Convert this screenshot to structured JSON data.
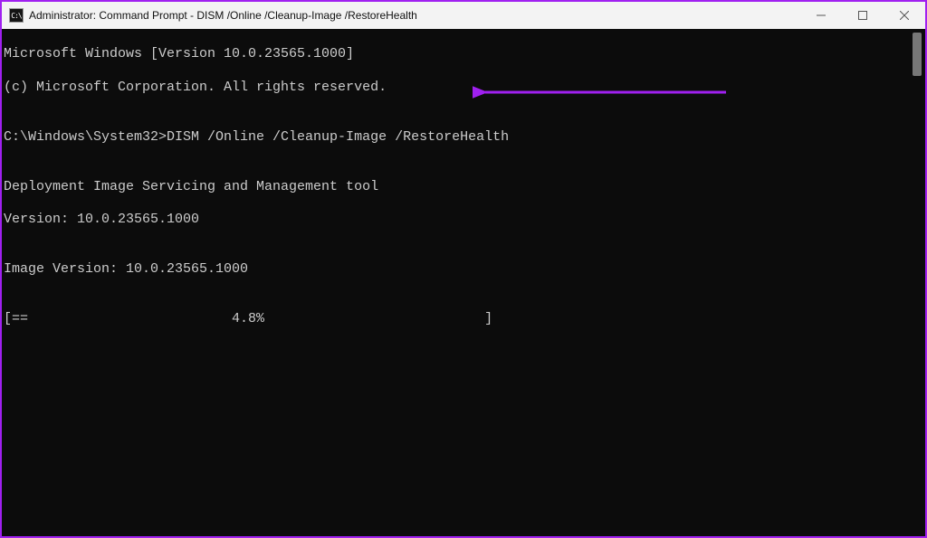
{
  "title": "Administrator: Command Prompt - DISM  /Online /Cleanup-Image /RestoreHealth",
  "app_icon_label": "C:\\",
  "console": {
    "line1": "Microsoft Windows [Version 10.0.23565.1000]",
    "line2": "(c) Microsoft Corporation. All rights reserved.",
    "blank1": "",
    "prompt_line": "C:\\Windows\\System32>DISM /Online /Cleanup-Image /RestoreHealth",
    "blank2": "",
    "tool_line1": "Deployment Image Servicing and Management tool",
    "tool_line2": "Version: 10.0.23565.1000",
    "blank3": "",
    "image_version": "Image Version: 10.0.23565.1000",
    "blank4": "",
    "progress": "[==                         4.8%                           ]"
  },
  "progress_percent": 4.8,
  "annotation_color": "#a020f0"
}
